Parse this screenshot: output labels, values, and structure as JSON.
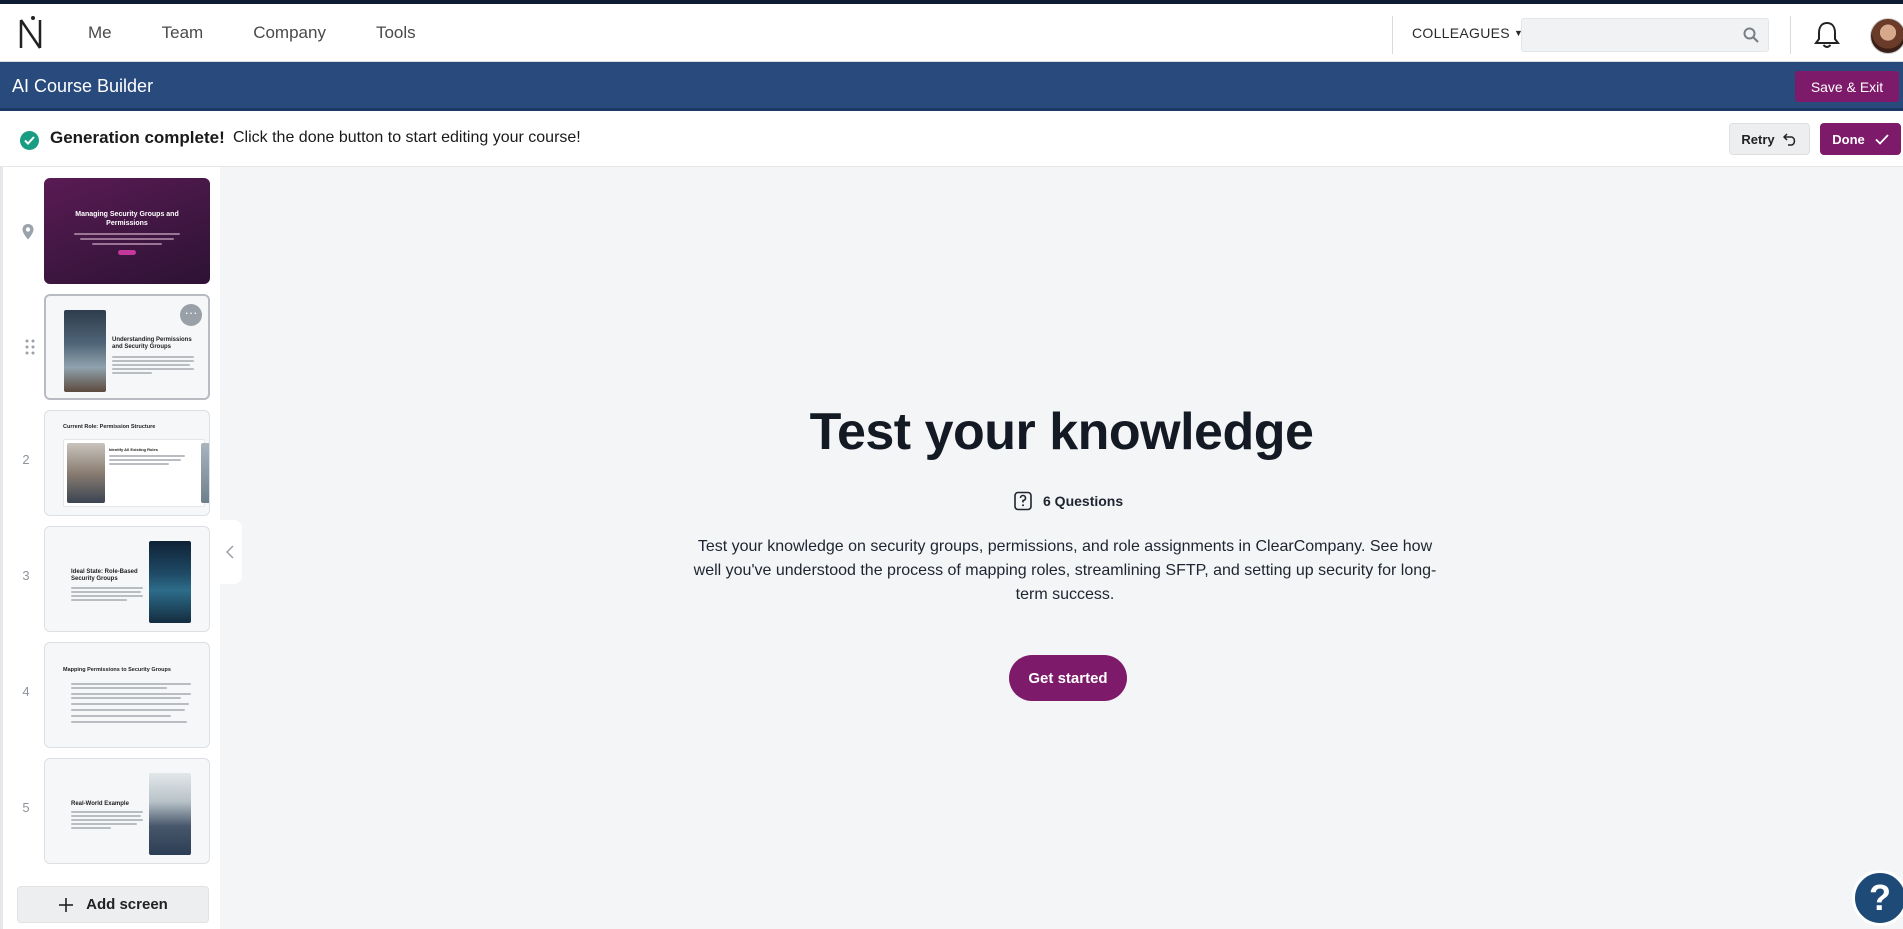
{
  "topnav": {
    "links": [
      "Me",
      "Team",
      "Company",
      "Tools"
    ],
    "colleagues_label": "COLLEAGUES",
    "search_placeholder": "",
    "icons": {
      "logo": "brand-logo",
      "search": "search-icon",
      "notifications": "bell-icon"
    }
  },
  "builder": {
    "title": "AI Course Builder",
    "save_exit_label": "Save & Exit"
  },
  "status": {
    "headline": "Generation complete!",
    "message": "Click the done button to start editing your course!",
    "retry_label": "Retry",
    "done_label": "Done"
  },
  "sidebar": {
    "slides": [
      {
        "marker": "",
        "marker_icon": "location-pin-icon",
        "title": "Managing Security Groups and Permissions",
        "selected": false
      },
      {
        "marker": "",
        "marker_icon": "drag-handle-icon",
        "title": "Understanding Permissions and Security Groups",
        "selected": true
      },
      {
        "marker": "2",
        "title": "Current Role: Permission Structure",
        "card_title": "Identify All Existing Roles",
        "selected": false
      },
      {
        "marker": "3",
        "title": "Ideal State: Role-Based Security Groups",
        "selected": false
      },
      {
        "marker": "4",
        "title": "Mapping Permissions to Security Groups",
        "selected": false
      },
      {
        "marker": "5",
        "title": "Real-World Example",
        "selected": false
      }
    ],
    "add_screen_label": "Add screen"
  },
  "main": {
    "title": "Test your knowledge",
    "question_count": "6 Questions",
    "description": "Test your knowledge on security groups, permissions, and role assignments in ClearCompany. See how well you've understood the process of mapping roles, streamlining SFTP, and setting up security for long-term success.",
    "cta_label": "Get started"
  },
  "help": {
    "label": "?"
  },
  "colors": {
    "brand_purple": "#7d1a6a",
    "builder_blue": "#284a7c",
    "success_green": "#1a9c83"
  }
}
